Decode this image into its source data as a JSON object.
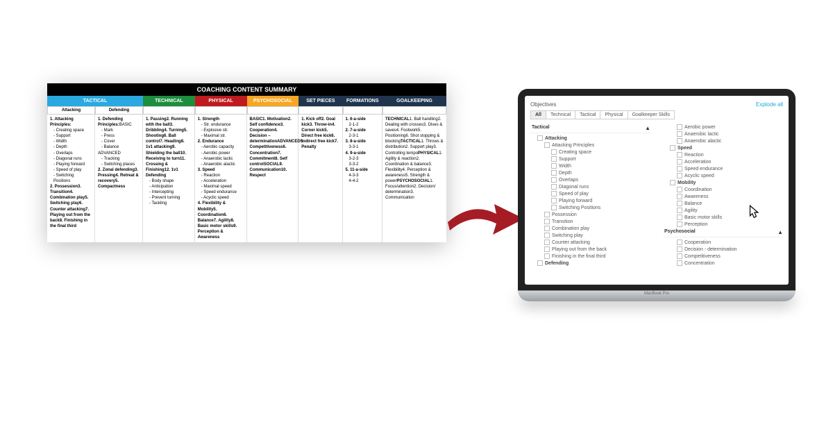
{
  "sheet": {
    "title": "COACHING CONTENT SUMMARY",
    "headers": {
      "tactical": "TACTICAL",
      "technical": "TECHNICAL",
      "physical": "PHYSICAL",
      "psychosocial": "PSYCHOSOCIAL",
      "set_pieces": "SET PIECES",
      "formations": "FORMATIONS",
      "goalkeeping": "GOALKEEPING",
      "attacking": "Attacking",
      "defending": "Defending"
    },
    "cols": {
      "attacking": [
        {
          "t": "1. Attacking Principles:",
          "b": 1
        },
        {
          "t": "- Creating space",
          "i": 1
        },
        {
          "t": "- Support",
          "i": 1
        },
        {
          "t": "- Width",
          "i": 1
        },
        {
          "t": "- Depth",
          "i": 1
        },
        {
          "t": "- Overlaps",
          "i": 1
        },
        {
          "t": "- Diagonal runs",
          "i": 1
        },
        {
          "t": "- Playing forward",
          "i": 1
        },
        {
          "t": "- Speed of play",
          "i": 1
        },
        {
          "t": "- Switching Positions",
          "i": 1
        },
        {
          "t": "2. Possession",
          "b": 1
        },
        {
          "t": "3. Transition",
          "b": 1
        },
        {
          "t": "4. Combination play",
          "b": 1
        },
        {
          "t": "5. Switching play",
          "b": 1
        },
        {
          "t": "6. Counter attacking",
          "b": 1
        },
        {
          "t": "7. Playing out from the back",
          "b": 1
        },
        {
          "t": "8. Finishing in the final third",
          "b": 1
        }
      ],
      "defending": [
        {
          "t": "1. Defending Principles:",
          "b": 1
        },
        {
          "t": "BASIC"
        },
        {
          "t": "- Mark",
          "i": 1
        },
        {
          "t": "- Press",
          "i": 1
        },
        {
          "t": "- Cover",
          "i": 1
        },
        {
          "t": "- Balance",
          "i": 1
        },
        {
          "t": "ADVANCED"
        },
        {
          "t": "- Tracking",
          "i": 1
        },
        {
          "t": "- Switching places",
          "i": 1
        },
        {
          "t": "2. Zonal defending",
          "b": 1
        },
        {
          "t": "3. Pressing",
          "b": 1
        },
        {
          "t": "4. Retreat & recovery",
          "b": 1
        },
        {
          "t": "5. Compactness",
          "b": 1
        }
      ],
      "technical": [
        {
          "t": "1. Passing",
          "b": 1
        },
        {
          "t": "2. Running with the ball",
          "b": 1
        },
        {
          "t": "3. Dribbling",
          "b": 1
        },
        {
          "t": "4. Turning",
          "b": 1
        },
        {
          "t": "5. Shooting",
          "b": 1
        },
        {
          "t": "6. Ball control",
          "b": 1
        },
        {
          "t": "7. Heading",
          "b": 1
        },
        {
          "t": "8. 1v1 attacking",
          "b": 1
        },
        {
          "t": "9. Shielding the ball",
          "b": 1
        },
        {
          "t": "10. Receiving to turn",
          "b": 1
        },
        {
          "t": "11. Crossing & Finishing",
          "b": 1
        },
        {
          "t": "12. 1v1 Defending",
          "b": 1
        },
        {
          "t": "- Body shape",
          "i": 1
        },
        {
          "t": "- Anticipation",
          "i": 1
        },
        {
          "t": "- Intercepting",
          "i": 1
        },
        {
          "t": "- Prevent turning",
          "i": 1
        },
        {
          "t": "- Tackling",
          "i": 1
        }
      ],
      "physical": [
        {
          "t": "1. Strength",
          "b": 1
        },
        {
          "t": "- Str. endurance",
          "i": 1
        },
        {
          "t": "- Explosive str.",
          "i": 1
        },
        {
          "t": "- Maximal str.",
          "i": 1
        },
        {
          "t": "2. Endurance",
          "b": 1
        },
        {
          "t": "- Aerobic capacity",
          "i": 1
        },
        {
          "t": "- Aerobic power",
          "i": 1
        },
        {
          "t": "- Anaerobic lactic",
          "i": 1
        },
        {
          "t": "- Anaerobic alactic",
          "i": 1
        },
        {
          "t": "3. Speed",
          "b": 1
        },
        {
          "t": "- Reaction",
          "i": 1
        },
        {
          "t": "- Acceleration",
          "i": 1
        },
        {
          "t": "- Maximal speed",
          "i": 1
        },
        {
          "t": "- Speed endurance",
          "i": 1
        },
        {
          "t": "- Acyclic speed",
          "i": 1
        },
        {
          "t": "4. Flexibility & Mobility",
          "b": 1
        },
        {
          "t": "5. Coordination",
          "b": 1
        },
        {
          "t": "6. Balance",
          "b": 1
        },
        {
          "t": "7. Agility",
          "b": 1
        },
        {
          "t": "8. Basic motor skills",
          "b": 1
        },
        {
          "t": "9. Perception & Awareness",
          "b": 1
        }
      ],
      "psychosocial": [
        {
          "t": "BASIC",
          "b": 1
        },
        {
          "t": "1. Motivation",
          "b": 1
        },
        {
          "t": "2. Self confidence",
          "b": 1
        },
        {
          "t": "3. Cooperation",
          "b": 1
        },
        {
          "t": "4. Decision – determination",
          "b": 1
        },
        {
          "t": ""
        },
        {
          "t": "ADVANCED",
          "b": 1
        },
        {
          "t": "5. Competitiveness",
          "b": 1
        },
        {
          "t": "6. Concentration",
          "b": 1
        },
        {
          "t": "7. Commitment",
          "b": 1
        },
        {
          "t": "8. Self control",
          "b": 1
        },
        {
          "t": ""
        },
        {
          "t": "SOCIAL",
          "b": 1
        },
        {
          "t": "9. Communication",
          "b": 1
        },
        {
          "t": "10. Respect",
          "b": 1
        }
      ],
      "set_pieces": [
        {
          "t": "1. Kick off",
          "b": 1
        },
        {
          "t": "2. Goal kick",
          "b": 1
        },
        {
          "t": "3. Throw-in",
          "b": 1
        },
        {
          "t": "4. Corner kick",
          "b": 1
        },
        {
          "t": "5. Direct free kick",
          "b": 1
        },
        {
          "t": "6. Indirect free kick",
          "b": 1
        },
        {
          "t": "7. Penalty",
          "b": 1
        }
      ],
      "formations": [
        {
          "t": "1. 6-a-side",
          "b": 1
        },
        {
          "t": "2-1-2",
          "i": 1
        },
        {
          "t": "2. 7-a-side",
          "b": 1
        },
        {
          "t": "2-3-1",
          "i": 1
        },
        {
          "t": "3. 8-a-side",
          "b": 1
        },
        {
          "t": "3-3-1",
          "i": 1
        },
        {
          "t": "4. 9-a-side",
          "b": 1
        },
        {
          "t": "3-2-3",
          "i": 1
        },
        {
          "t": "3-3-2",
          "i": 1
        },
        {
          "t": "5. 11-a-side",
          "b": 1
        },
        {
          "t": "4-3-3",
          "i": 1
        },
        {
          "t": "4-4-2",
          "i": 1
        }
      ],
      "goalkeeping": [
        {
          "t": "TECHNICAL",
          "b": 1
        },
        {
          "t": "1. Ball handling"
        },
        {
          "t": "2. Dealing with crosses"
        },
        {
          "t": "3. Dives & saves"
        },
        {
          "t": "4. Footwork"
        },
        {
          "t": "5. Positioning"
        },
        {
          "t": "6. Shot stopping & blocking"
        },
        {
          "t": "TACTICAL",
          "b": 1
        },
        {
          "t": "1. Throws & distribution"
        },
        {
          "t": "2. Support play"
        },
        {
          "t": "3. Controlling tempo"
        },
        {
          "t": "PHYSICAL",
          "b": 1
        },
        {
          "t": "1. Agility & reaction"
        },
        {
          "t": "2. Coordination & balance"
        },
        {
          "t": "3. Flexibility"
        },
        {
          "t": "4. Perception & awareness"
        },
        {
          "t": "5. Strength & power"
        },
        {
          "t": "PSYCHOSOCIAL",
          "b": 1
        },
        {
          "t": "1. Focus/attention"
        },
        {
          "t": "2. Decision/ determination"
        },
        {
          "t": "3. Communication"
        }
      ]
    }
  },
  "app": {
    "title": "Objectives",
    "explode": "Explode all",
    "tabs": [
      "All",
      "Technical",
      "Tactical",
      "Physical",
      "Goalkeeper Skills"
    ],
    "left": [
      {
        "t": "Tactical",
        "lvl": 1,
        "caret": "▲"
      },
      {
        "t": "Attacking",
        "lvl": 2
      },
      {
        "t": "Attacking Principles",
        "lvl": 3
      },
      {
        "t": "Creating space",
        "lvl": 4
      },
      {
        "t": "Support",
        "lvl": 4
      },
      {
        "t": "Width",
        "lvl": 4
      },
      {
        "t": "Depth",
        "lvl": 4
      },
      {
        "t": "Overlaps",
        "lvl": 4
      },
      {
        "t": "Diagonal runs",
        "lvl": 4
      },
      {
        "t": "Speed of play",
        "lvl": 4
      },
      {
        "t": "Playing forward",
        "lvl": 4
      },
      {
        "t": "Switching Positions",
        "lvl": 4
      },
      {
        "t": "Possession",
        "lvl": 3
      },
      {
        "t": "Transition",
        "lvl": 3
      },
      {
        "t": "Combination play",
        "lvl": 3
      },
      {
        "t": "Switching play",
        "lvl": 3
      },
      {
        "t": "Counter attacking",
        "lvl": 3
      },
      {
        "t": "Playing out from the back",
        "lvl": 3
      },
      {
        "t": "Finishing in the final third",
        "lvl": 3
      },
      {
        "t": "Defending",
        "lvl": 2
      }
    ],
    "right": [
      {
        "t": "Aerobic power",
        "lvl": 3
      },
      {
        "t": "Anaerobic lactic",
        "lvl": 3
      },
      {
        "t": "Anaerobic alactic",
        "lvl": 3
      },
      {
        "t": "Speed",
        "lvl": 2
      },
      {
        "t": "Reaction",
        "lvl": 3
      },
      {
        "t": "Acceleration",
        "lvl": 3
      },
      {
        "t": "Speed endurance",
        "lvl": 3
      },
      {
        "t": "Acyclic speed",
        "lvl": 3
      },
      {
        "t": "Mobility",
        "lvl": 2
      },
      {
        "t": "Coordination",
        "lvl": 3
      },
      {
        "t": "Awareness",
        "lvl": 3
      },
      {
        "t": "Balance",
        "lvl": 3
      },
      {
        "t": "Agility",
        "lvl": 3
      },
      {
        "t": "Basic motor skills",
        "lvl": 3
      },
      {
        "t": "Perception",
        "lvl": 3
      },
      {
        "t": "Psychosocial",
        "lvl": 1,
        "caret": "▲"
      },
      {
        "t": "Cooperation",
        "lvl": 3
      },
      {
        "t": "Decision - determination",
        "lvl": 3
      },
      {
        "t": "Competitiveness",
        "lvl": 3
      },
      {
        "t": "Concentration",
        "lvl": 3
      }
    ],
    "device": "MacBook Pro"
  }
}
